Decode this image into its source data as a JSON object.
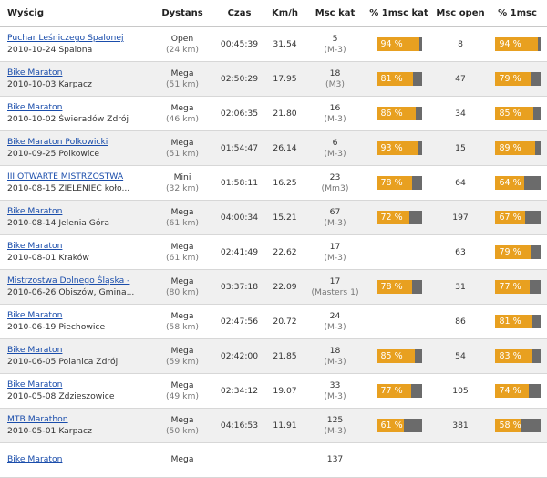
{
  "headers": [
    "Wyścig",
    "Dystans",
    "Czas",
    "Km/h",
    "Msc kat",
    "% 1msc kat",
    "Msc open",
    "% 1msc"
  ],
  "rows": [
    {
      "race": "Puchar Leśniczego Spalonej",
      "date_place": "2010-10-24 Spalona",
      "distance": "Open",
      "distance_km": "(24 km)",
      "time": "00:45:39",
      "speed": "31.54",
      "cat_pos": "5",
      "cat_name": "(M-3)",
      "pct_cat": "94 %",
      "pct_cat_value": 94,
      "open_pos": "8",
      "pct_open": "94 %",
      "pct_open_value": 94
    },
    {
      "race": "Bike Maraton",
      "date_place": "2010-10-03 Karpacz",
      "distance": "Mega",
      "distance_km": "(51 km)",
      "time": "02:50:29",
      "speed": "17.95",
      "cat_pos": "18",
      "cat_name": "(M3)",
      "pct_cat": "81 %",
      "pct_cat_value": 81,
      "open_pos": "47",
      "pct_open": "79 %",
      "pct_open_value": 79
    },
    {
      "race": "Bike Maraton",
      "date_place": "2010-10-02 Świeradów Zdrój",
      "distance": "Mega",
      "distance_km": "(46 km)",
      "time": "02:06:35",
      "speed": "21.80",
      "cat_pos": "16",
      "cat_name": "(M-3)",
      "pct_cat": "86 %",
      "pct_cat_value": 86,
      "open_pos": "34",
      "pct_open": "85 %",
      "pct_open_value": 85
    },
    {
      "race": "Bike Maraton Polkowicki",
      "date_place": "2010-09-25 Polkowice",
      "distance": "Mega",
      "distance_km": "(51 km)",
      "time": "01:54:47",
      "speed": "26.14",
      "cat_pos": "6",
      "cat_name": "(M-3)",
      "pct_cat": "93 %",
      "pct_cat_value": 93,
      "open_pos": "15",
      "pct_open": "89 %",
      "pct_open_value": 89
    },
    {
      "race": "III OTWARTE MISTRZOSTWA",
      "date_place": "2010-08-15 ZIELENIEC koło...",
      "distance": "Mini",
      "distance_km": "(32 km)",
      "time": "01:58:11",
      "speed": "16.25",
      "cat_pos": "23",
      "cat_name": "(Mm3)",
      "pct_cat": "78 %",
      "pct_cat_value": 78,
      "open_pos": "64",
      "pct_open": "64 %",
      "pct_open_value": 64
    },
    {
      "race": "Bike Maraton",
      "date_place": "2010-08-14 Jelenia Góra",
      "distance": "Mega",
      "distance_km": "(61 km)",
      "time": "04:00:34",
      "speed": "15.21",
      "cat_pos": "67",
      "cat_name": "(M-3)",
      "pct_cat": "72 %",
      "pct_cat_value": 72,
      "open_pos": "197",
      "pct_open": "67 %",
      "pct_open_value": 67
    },
    {
      "race": "Bike Maraton",
      "date_place": "2010-08-01 Kraków",
      "distance": "Mega",
      "distance_km": "(61 km)",
      "time": "02:41:49",
      "speed": "22.62",
      "cat_pos": "17",
      "cat_name": "(M-3)",
      "pct_cat": "",
      "pct_cat_value": null,
      "open_pos": "63",
      "pct_open": "79 %",
      "pct_open_value": 79
    },
    {
      "race": "Mistrzostwa Dolnego Śląska -",
      "date_place": "2010-06-26 Obiszów, Gmina...",
      "distance": "Mega",
      "distance_km": "(80 km)",
      "time": "03:37:18",
      "speed": "22.09",
      "cat_pos": "17",
      "cat_name": "(Masters 1)",
      "pct_cat": "78 %",
      "pct_cat_value": 78,
      "open_pos": "31",
      "pct_open": "77 %",
      "pct_open_value": 77
    },
    {
      "race": "Bike Maraton",
      "date_place": "2010-06-19 Piechowice",
      "distance": "Mega",
      "distance_km": "(58 km)",
      "time": "02:47:56",
      "speed": "20.72",
      "cat_pos": "24",
      "cat_name": "(M-3)",
      "pct_cat": "",
      "pct_cat_value": null,
      "open_pos": "86",
      "pct_open": "81 %",
      "pct_open_value": 81
    },
    {
      "race": "Bike Maraton",
      "date_place": "2010-06-05 Polanica Zdrój",
      "distance": "Mega",
      "distance_km": "(59 km)",
      "time": "02:42:00",
      "speed": "21.85",
      "cat_pos": "18",
      "cat_name": "(M-3)",
      "pct_cat": "85 %",
      "pct_cat_value": 85,
      "open_pos": "54",
      "pct_open": "83 %",
      "pct_open_value": 83
    },
    {
      "race": "Bike Maraton",
      "date_place": "2010-05-08 Zdzieszowice",
      "distance": "Mega",
      "distance_km": "(49 km)",
      "time": "02:34:12",
      "speed": "19.07",
      "cat_pos": "33",
      "cat_name": "(M-3)",
      "pct_cat": "77 %",
      "pct_cat_value": 77,
      "open_pos": "105",
      "pct_open": "74 %",
      "pct_open_value": 74
    },
    {
      "race": "MTB Marathon",
      "date_place": "2010-05-01 Karpacz",
      "distance": "Mega",
      "distance_km": "(50 km)",
      "time": "04:16:53",
      "speed": "11.91",
      "cat_pos": "125",
      "cat_name": "(M-3)",
      "pct_cat": "61 %",
      "pct_cat_value": 61,
      "open_pos": "381",
      "pct_open": "58 %",
      "pct_open_value": 58
    },
    {
      "race": "Bike Maraton",
      "date_place": "",
      "distance": "Mega",
      "distance_km": "",
      "time": "",
      "speed": "",
      "cat_pos": "137",
      "cat_name": "",
      "pct_cat": "",
      "pct_cat_value": null,
      "open_pos": "",
      "pct_open": "",
      "pct_open_value": null
    }
  ]
}
